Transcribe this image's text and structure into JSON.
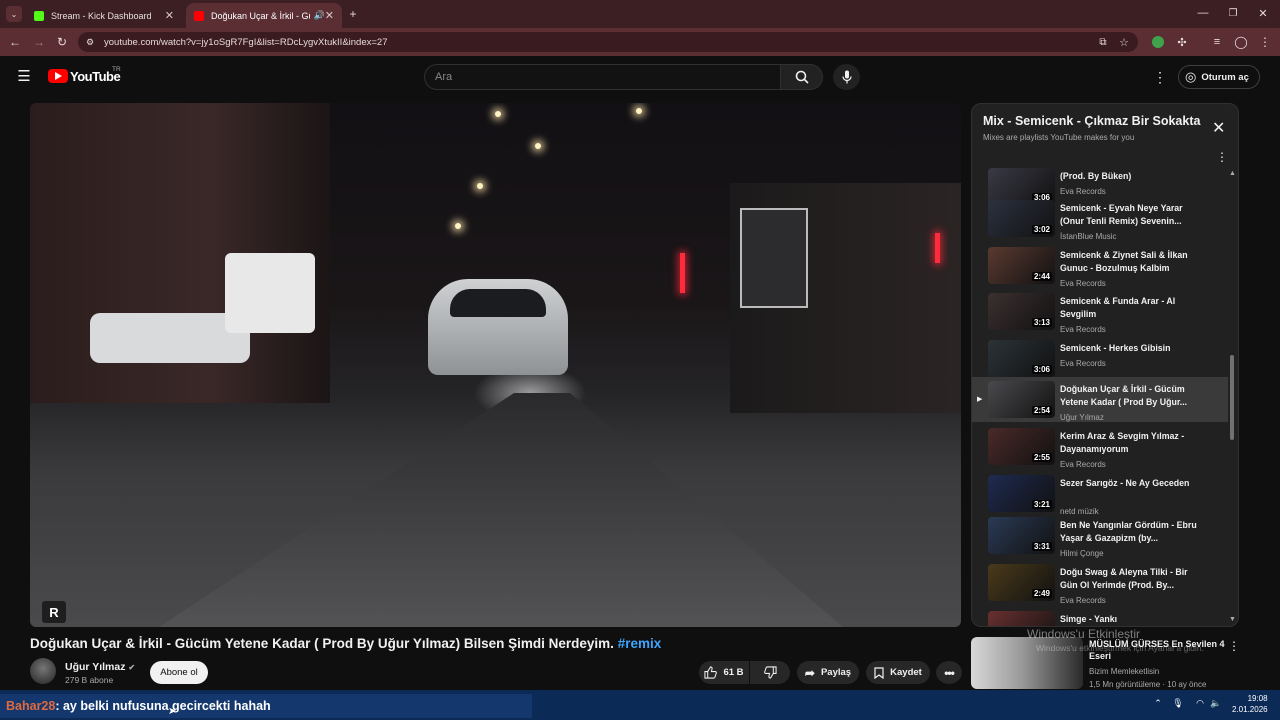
{
  "browser": {
    "tabs": [
      {
        "label": "Stream - Kick Dashboard",
        "icon": "kick-icon",
        "color": "#53fc18"
      },
      {
        "label": "Doğukan Uçar & İrkil - Gücü",
        "icon": "youtube-icon",
        "color": "#ff0000"
      }
    ],
    "url": "youtube.com/watch?v=jy1oSgR7FgI&list=RDcLygvXtukII&index=27"
  },
  "youtube": {
    "logo": "YouTube",
    "region": "TR",
    "search_placeholder": "Ara",
    "signin_label": "Oturum aç"
  },
  "video": {
    "title": "Doğukan Uçar & İrkil - Gücüm Yetene Kadar ( Prod By Uğur Yılmaz) Bilsen Şimdi Nerdeyim.",
    "hashtag": "#remix",
    "watermark": "R",
    "channel": "Uğur Yılmaz",
    "subscribers": "279 B abone",
    "subscribe_label": "Abone ol",
    "likes": "61 B",
    "share_label": "Paylaş",
    "save_label": "Kaydet"
  },
  "playlist": {
    "title": "Mix - Semicenk - Çıkmaz Bir Sokakta",
    "subtitle": "Mixes are playlists YouTube makes for you",
    "items": [
      {
        "title": "(Prod. By Büken)",
        "channel": "Eva Records",
        "duration": "3:06",
        "current": false
      },
      {
        "title": "Semicenk - Eyvah Neye Yarar (Onur Tenli Remix) Sevenin...",
        "channel": "İstanBlue Music",
        "duration": "3:02",
        "current": false
      },
      {
        "title": "Semicenk & Ziynet Sali & İlkan Gunuc - Bozulmuş Kalbim",
        "channel": "Eva Records",
        "duration": "2:44",
        "current": false
      },
      {
        "title": "Semicenk & Funda Arar - Al Sevgilim",
        "channel": "Eva Records",
        "duration": "3:13",
        "current": false
      },
      {
        "title": "Semicenk - Herkes Gibisin",
        "channel": "Eva Records",
        "duration": "3:06",
        "current": false
      },
      {
        "title": "Doğukan Uçar & İrkil - Gücüm Yetene Kadar ( Prod By Uğur...",
        "channel": "Uğur Yılmaz",
        "duration": "2:54",
        "current": true
      },
      {
        "title": "Kerim Araz & Sevgim Yılmaz - Dayanamıyorum",
        "channel": "Eva Records",
        "duration": "2:55",
        "current": false
      },
      {
        "title": "Sezer Sarıgöz - Ne Ay Geceden",
        "channel": "netd müzik",
        "duration": "3:21",
        "current": false
      },
      {
        "title": "Ben Ne Yangınlar Gördüm - Ebru Yaşar & Gazapizm (by...",
        "channel": "Hilmi Çonge",
        "duration": "3:31",
        "current": false
      },
      {
        "title": "Doğu Swag & Aleyna Tilki - Bir Gün Ol Yerimde (Prod. By...",
        "channel": "Eva Records",
        "duration": "2:49",
        "current": false
      },
      {
        "title": "Simge - Yankı",
        "channel": "",
        "duration": "",
        "current": false
      }
    ]
  },
  "related": {
    "title": "MÜSLÜM GÜRSES En Sevilen 4 Eseri",
    "channel": "Bizim Memleketlisin",
    "meta": "1,5 Mn görüntüleme · 10 ay önce"
  },
  "windows_activation": {
    "title": "Windows'u Etkinleştir",
    "subtitle": "Windows'u etkinleştirmek için Ayarlar'a gidin."
  },
  "chat_overlay": {
    "user": "Bahar28",
    "message": ": ay belki nufusuna gecircekti hahah"
  },
  "taskbar": {
    "time": "19:08",
    "date": "2.01.2026"
  }
}
